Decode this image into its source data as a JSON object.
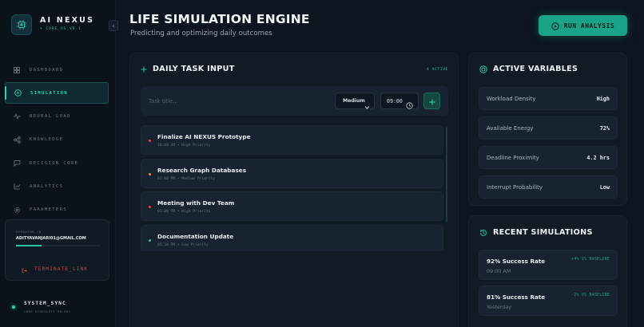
{
  "brand": {
    "name": "AI NEXUS",
    "version": "• CORE_OS_V8.1"
  },
  "nav": {
    "items": [
      {
        "label": "DASHBOARD",
        "icon": "grid-icon",
        "active": false
      },
      {
        "label": "SIMULATION",
        "icon": "play-circle-icon",
        "active": true
      },
      {
        "label": "NEURAL LOAD",
        "icon": "pulse-icon",
        "active": false
      },
      {
        "label": "KNOWLEDGE",
        "icon": "share-nodes-icon",
        "active": false
      },
      {
        "label": "DECISION CORE",
        "icon": "message-square-icon",
        "active": false
      },
      {
        "label": "ANALYTICS",
        "icon": "line-chart-icon",
        "active": false
      },
      {
        "label": "PARAMETERS",
        "icon": "gear-icon",
        "active": false
      }
    ]
  },
  "operator": {
    "caption": "OPERATOR_ID",
    "email": "ADITYAVANJARI01@GMAIL.COM",
    "progress": 0.3,
    "terminate_label": "TERMINATE_LINK"
  },
  "system": {
    "title": "SYSTEM_SYNC",
    "subtitle": "CORE STABILITY 98.98%"
  },
  "header": {
    "title": "LIFE SIMULATION ENGINE",
    "subtitle": "Predicting and optimizing daily outcomes",
    "run_label": "RUN ANALYSIS"
  },
  "task_panel": {
    "title": "DAILY TASK INPUT",
    "active_count": "4 ACTIVE",
    "input_placeholder": "Task title...",
    "priority_value": "Medium",
    "time_value": "09:00",
    "tasks": [
      {
        "title": "Finalize AI NEXUS Prototype",
        "meta": "10:00 AM • High Priority",
        "color": "#e04848"
      },
      {
        "title": "Research Graph Databases",
        "meta": "01:00 PM • Medium Priority",
        "color": "#e0982b"
      },
      {
        "title": "Meeting with Dev Team",
        "meta": "03:00 PM • High Priority",
        "color": "#e04848"
      },
      {
        "title": "Documentation Update",
        "meta": "05:30 PM • Low Priority",
        "color": "#2bc4a4"
      }
    ]
  },
  "variables_panel": {
    "title": "ACTIVE VARIABLES",
    "items": [
      {
        "label": "Workload Density",
        "value": "High"
      },
      {
        "label": "Available Energy",
        "value": "72%"
      },
      {
        "label": "Deadline Proximity",
        "value": "4.2 hrs"
      },
      {
        "label": "Interrupt Probability",
        "value": "Low"
      }
    ]
  },
  "recent_panel": {
    "title": "RECENT SIMULATIONS",
    "items": [
      {
        "title": "92% Success Rate",
        "time": "09:00 AM",
        "delta": "+4% VS BASELINE"
      },
      {
        "title": "81% Success Rate",
        "time": "Yesterday",
        "delta": "-2% VS BASELINE"
      }
    ]
  },
  "colors": {
    "accent": "#2bc4a4",
    "danger": "#c64848",
    "background": "#0d1620"
  }
}
